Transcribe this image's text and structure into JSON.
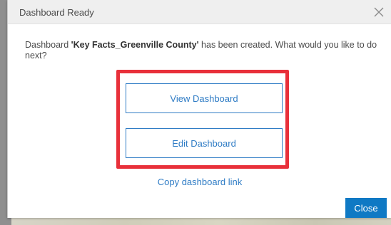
{
  "dialog": {
    "title": "Dashboard Ready",
    "close_icon": "close-icon",
    "message_prefix": "Dashboard ",
    "dashboard_name": "'Key Facts_Greenville County'",
    "message_suffix": " has been created. What would you like to do next?",
    "view_button": "View Dashboard",
    "edit_button": "Edit Dashboard",
    "copy_link": "Copy dashboard link",
    "close_button": "Close"
  },
  "colors": {
    "accent": "#2f7cc5",
    "primary_button": "#0f79c4",
    "highlight": "#e8303a",
    "header_bg": "#efefef"
  }
}
